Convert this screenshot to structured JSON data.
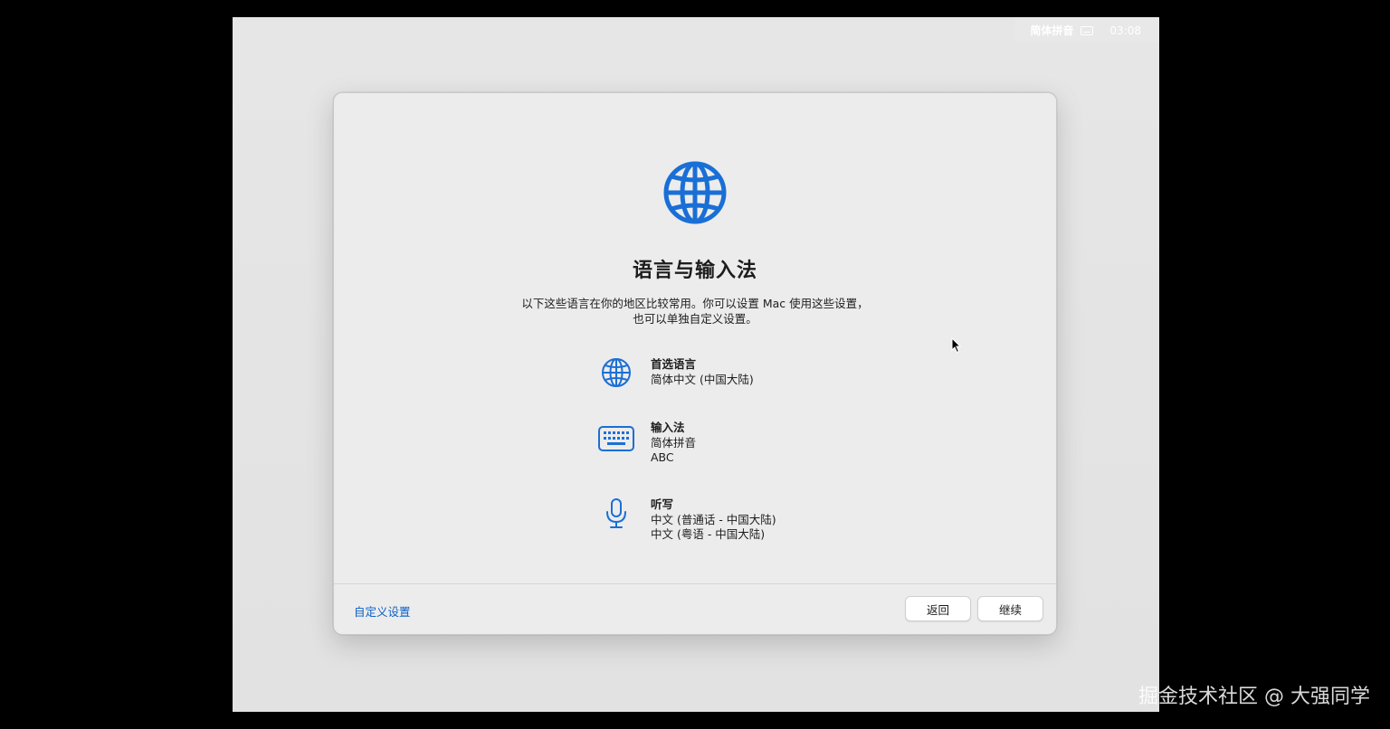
{
  "menubar": {
    "input_source": "简体拼音",
    "keyboard_icon": "keyboard-icon",
    "clock": "03:08"
  },
  "dialog": {
    "hero_icon": "globe-icon",
    "title": "语言与输入法",
    "subtitle_line1": "以下这些语言在你的地区比较常用。你可以设置 Mac 使用这些设置，",
    "subtitle_line2": "也可以单独自定义设置。",
    "settings": [
      {
        "icon": "globe-icon",
        "label": "首选语言",
        "values": [
          "简体中文 (中国大陆)"
        ]
      },
      {
        "icon": "keyboard-icon",
        "label": "输入法",
        "values": [
          "简体拼音",
          "ABC"
        ]
      },
      {
        "icon": "microphone-icon",
        "label": "听写",
        "values": [
          "中文 (普通话 - 中国大陆)",
          "中文 (粤语 - 中国大陆)"
        ]
      }
    ],
    "customize_link": "自定义设置",
    "back_button": "返回",
    "continue_button": "继续"
  },
  "colors": {
    "accent": "#0a60c8",
    "icon_blue": "#1a6fd6"
  },
  "watermark": "掘金技术社区 @ 大强同学"
}
